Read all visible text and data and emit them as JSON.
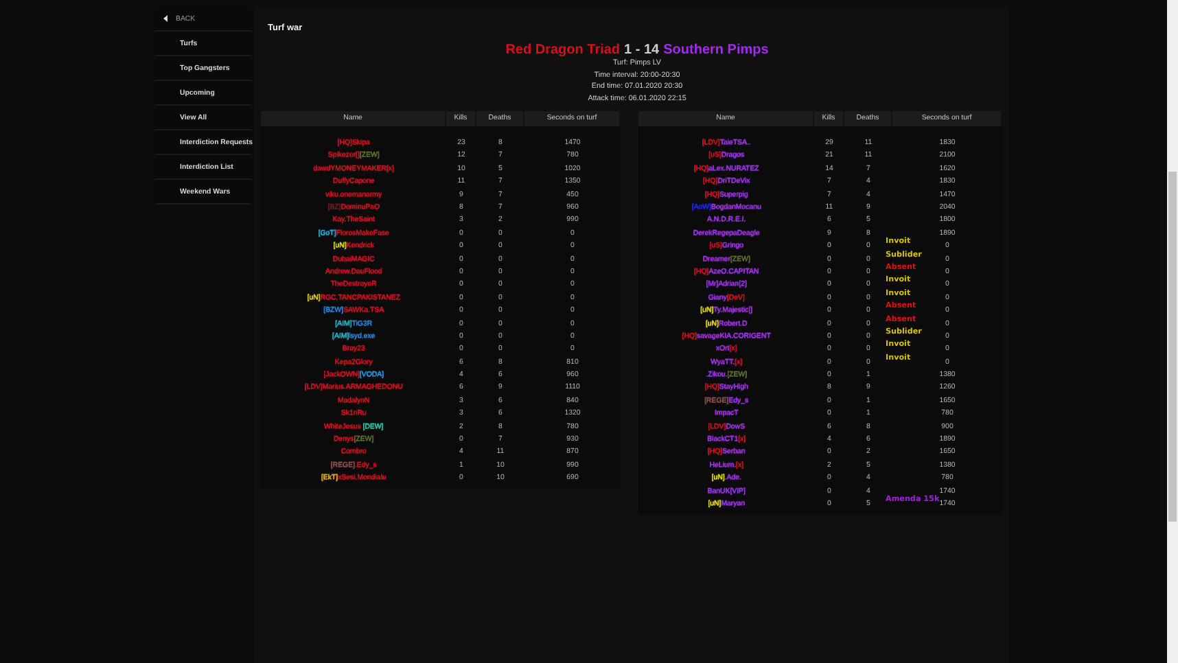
{
  "sidebar": {
    "items": [
      {
        "label": "BACK",
        "kind": "back"
      },
      {
        "label": "Turfs",
        "kind": "link"
      },
      {
        "label": "Top Gangsters",
        "kind": "link"
      },
      {
        "label": "Upcoming",
        "kind": "link"
      },
      {
        "label": "View All",
        "kind": "link"
      },
      {
        "label": "Interdiction Requests",
        "kind": "link"
      },
      {
        "label": "Interdiction List",
        "kind": "link"
      },
      {
        "label": "Weekend Wars",
        "kind": "link"
      }
    ]
  },
  "page_title": "Turf war",
  "matchup": [
    {
      "text": "Red Dragon Triad",
      "color": "#d8101c"
    },
    {
      "text": "1 - 14",
      "color": "#cfcfcf"
    },
    {
      "text": "Southern Pimps",
      "color": "#a12bf0"
    }
  ],
  "info": [
    "Turf: Pimps LV",
    "Time interval: 20:00-20:30",
    "End time: 07.01.2020 20:30",
    "Attack time: 06.01.2020 22:15"
  ],
  "tables": [
    {
      "columns": [
        "Name",
        "Kills",
        "Deaths",
        "Seconds on turf"
      ],
      "rows": [
        {
          "name": [
            {
              "text": "[HQ]Skipa",
              "color": "#c8101e"
            }
          ],
          "kills": "23",
          "deaths": "8",
          "seconds": "1470"
        },
        {
          "name": [
            {
              "text": "Spikezor[]",
              "color": "#c8101e"
            },
            {
              "text": "[ZEW]",
              "color": "#5a6b2a"
            }
          ],
          "kills": "12",
          "deaths": "7",
          "seconds": "780"
        },
        {
          "name": [
            {
              "text": "dawdYMONEYMAKER[x]",
              "color": "#c8101e"
            }
          ],
          "kills": "10",
          "deaths": "5",
          "seconds": "1020"
        },
        {
          "name": [
            {
              "text": "DuffyCapone",
              "color": "#c8101e"
            }
          ],
          "kills": "11",
          "deaths": "7",
          "seconds": "1350"
        },
        {
          "name": [
            {
              "text": "viku.onemanarmy",
              "color": "#c8101e"
            }
          ],
          "kills": "9",
          "deaths": "7",
          "seconds": "450"
        },
        {
          "name": [
            {
              "text": "[BZ]",
              "color": "#6a1a22"
            },
            {
              "text": "DominuPaO",
              "color": "#c8101e"
            }
          ],
          "kills": "8",
          "deaths": "7",
          "seconds": "960"
        },
        {
          "name": [
            {
              "text": "Kay.TheSaint",
              "color": "#c8101e"
            }
          ],
          "kills": "3",
          "deaths": "2",
          "seconds": "990"
        },
        {
          "name": [
            {
              "text": "[GoT]",
              "color": "#1fa8d0"
            },
            {
              "text": "FlorosMakeFase",
              "color": "#c8101e"
            }
          ],
          "kills": "0",
          "deaths": "0",
          "seconds": "0"
        },
        {
          "name": [
            {
              "text": "[uN]",
              "color": "#d8d000"
            },
            {
              "text": "Kendrick",
              "color": "#c8101e"
            }
          ],
          "kills": "0",
          "deaths": "0",
          "seconds": "0"
        },
        {
          "name": [
            {
              "text": "DubaiMAGIC",
              "color": "#c8101e"
            }
          ],
          "kills": "0",
          "deaths": "0",
          "seconds": "0"
        },
        {
          "name": [
            {
              "text": "Andrew.DauFlood",
              "color": "#c8101e"
            }
          ],
          "kills": "0",
          "deaths": "0",
          "seconds": "0"
        },
        {
          "name": [
            {
              "text": "TheDestroyeR",
              "color": "#c8101e"
            }
          ],
          "kills": "0",
          "deaths": "0",
          "seconds": "0"
        },
        {
          "name": [
            {
              "text": "[uN]",
              "color": "#d8d000"
            },
            {
              "text": "RGC.TANCPAKISTANEZ",
              "color": "#c8101e"
            }
          ],
          "kills": "0",
          "deaths": "0",
          "seconds": "0"
        },
        {
          "name": [
            {
              "text": "[BZW]",
              "color": "#1f7fd0"
            },
            {
              "text": "SAWKa.TSA",
              "color": "#c8101e"
            }
          ],
          "kills": "0",
          "deaths": "0",
          "seconds": "0"
        },
        {
          "name": [
            {
              "text": "[AIM]",
              "color": "#19b0b8"
            },
            {
              "text": "TiG3R",
              "color": "#1f7fd0"
            }
          ],
          "kills": "0",
          "deaths": "0",
          "seconds": "0"
        },
        {
          "name": [
            {
              "text": "[AIM]",
              "color": "#19b0b8"
            },
            {
              "text": "lsyd.exe",
              "color": "#1f7fd0"
            }
          ],
          "kills": "0",
          "deaths": "0",
          "seconds": "0"
        },
        {
          "name": [
            {
              "text": "Bray23",
              "color": "#c8101e"
            }
          ],
          "kills": "0",
          "deaths": "0",
          "seconds": "0"
        },
        {
          "name": [
            {
              "text": "Kepa2Glory",
              "color": "#c8101e"
            }
          ],
          "kills": "6",
          "deaths": "8",
          "seconds": "810"
        },
        {
          "name": [
            {
              "text": "[JackOWN]",
              "color": "#c8101e"
            },
            {
              "text": "[VODA]",
              "color": "#1f8fd8"
            }
          ],
          "kills": "4",
          "deaths": "6",
          "seconds": "960"
        },
        {
          "name": [
            {
              "text": "[LDV]Marius.ARMAGHEDONU",
              "color": "#c8101e"
            }
          ],
          "kills": "6",
          "deaths": "9",
          "seconds": "1110"
        },
        {
          "name": [
            {
              "text": "MadalynN",
              "color": "#c8101e"
            }
          ],
          "kills": "3",
          "deaths": "6",
          "seconds": "840"
        },
        {
          "name": [
            {
              "text": "Sk1nRu",
              "color": "#c8101e"
            }
          ],
          "kills": "3",
          "deaths": "6",
          "seconds": "1320"
        },
        {
          "name": [
            {
              "text": "WhiteJesus ",
              "color": "#c8101e"
            },
            {
              "text": "[DEW]",
              "color": "#20c0a0"
            }
          ],
          "kills": "2",
          "deaths": "8",
          "seconds": "780"
        },
        {
          "name": [
            {
              "text": "Denys",
              "color": "#c8101e"
            },
            {
              "text": "[ZEW]",
              "color": "#5a6b2a"
            }
          ],
          "kills": "0",
          "deaths": "7",
          "seconds": "930"
        },
        {
          "name": [
            {
              "text": "Combro",
              "color": "#c8101e"
            }
          ],
          "kills": "4",
          "deaths": "11",
          "seconds": "870"
        },
        {
          "name": [
            {
              "text": "[REGE]",
              "color": "#8a4a4a"
            },
            {
              "text": ".Edy_s",
              "color": "#c8101e"
            }
          ],
          "kills": "1",
          "deaths": "10",
          "seconds": "990"
        },
        {
          "name": [
            {
              "text": "[EkT]",
              "color": "#e0a000"
            },
            {
              "text": "xSesi.Mondialu",
              "color": "#c8101e"
            }
          ],
          "kills": "0",
          "deaths": "10",
          "seconds": "690"
        }
      ]
    },
    {
      "columns": [
        "Name",
        "Kills",
        "Deaths",
        "Seconds on turf"
      ],
      "rows": [
        {
          "name": [
            {
              "text": "[LDV]",
              "color": "#c8101e"
            },
            {
              "text": "TaieTSA..",
              "color": "#9a2ee0"
            }
          ],
          "kills": "29",
          "deaths": "11",
          "seconds": "1830"
        },
        {
          "name": [
            {
              "text": "[uS]",
              "color": "#c8101e"
            },
            {
              "text": "Dragos",
              "color": "#9a2ee0"
            }
          ],
          "kills": "21",
          "deaths": "11",
          "seconds": "2100"
        },
        {
          "name": [
            {
              "text": "[HQ]",
              "color": "#c8101e"
            },
            {
              "text": "aLex.NURATEZ",
              "color": "#9a2ee0"
            }
          ],
          "kills": "14",
          "deaths": "7",
          "seconds": "1620"
        },
        {
          "name": [
            {
              "text": "[HQ]",
              "color": "#c8101e"
            },
            {
              "text": "DriTDeVix",
              "color": "#9a2ee0"
            }
          ],
          "kills": "7",
          "deaths": "4",
          "seconds": "1830"
        },
        {
          "name": [
            {
              "text": "[HQ]",
              "color": "#c8101e"
            },
            {
              "text": "Superpig",
              "color": "#9a2ee0"
            }
          ],
          "kills": "7",
          "deaths": "4",
          "seconds": "1470"
        },
        {
          "name": [
            {
              "text": "[AoW]",
              "color": "#2020f0"
            },
            {
              "text": "BogdanMocanu",
              "color": "#9a2ee0"
            }
          ],
          "kills": "11",
          "deaths": "9",
          "seconds": "2040"
        },
        {
          "name": [
            {
              "text": "A.N.D.R.E.I.",
              "color": "#9a2ee0"
            }
          ],
          "kills": "6",
          "deaths": "5",
          "seconds": "1800"
        },
        {
          "name": [
            {
              "text": "DerekRegepaDeagle",
              "color": "#9a2ee0"
            }
          ],
          "kills": "9",
          "deaths": "8",
          "seconds": "1890"
        },
        {
          "name": [
            {
              "text": "[uS]",
              "color": "#c8101e"
            },
            {
              "text": "Gringo",
              "color": "#9a2ee0"
            }
          ],
          "kills": "0",
          "deaths": "0",
          "seconds": "0",
          "note": {
            "text": "Invoit",
            "color": "#d8c000"
          }
        },
        {
          "name": [
            {
              "text": "Dreamer",
              "color": "#9a2ee0"
            },
            {
              "text": "[ZEW]",
              "color": "#5a6b2a"
            }
          ],
          "kills": "0",
          "deaths": "0",
          "seconds": "0",
          "note": {
            "text": "Sublider",
            "color": "#d8c000"
          }
        },
        {
          "name": [
            {
              "text": "[HQ]",
              "color": "#c8101e"
            },
            {
              "text": "AzeO.CAPITAN",
              "color": "#9a2ee0"
            }
          ],
          "kills": "0",
          "deaths": "0",
          "seconds": "0",
          "note": {
            "text": "Absent",
            "color": "#e01010"
          }
        },
        {
          "name": [
            {
              "text": "[Mr]Adrian[2]",
              "color": "#9a2ee0"
            }
          ],
          "kills": "0",
          "deaths": "0",
          "seconds": "0",
          "note": {
            "text": "Invoit",
            "color": "#d8c000"
          }
        },
        {
          "name": [
            {
              "text": "Giany",
              "color": "#9a2ee0"
            },
            {
              "text": "[DeV]",
              "color": "#c8101e"
            }
          ],
          "kills": "0",
          "deaths": "0",
          "seconds": "0",
          "note": {
            "text": "Invoit",
            "color": "#d8c000"
          }
        },
        {
          "name": [
            {
              "text": "[uN]",
              "color": "#d8d000"
            },
            {
              "text": "Ty.Majestic[]",
              "color": "#9a2ee0"
            }
          ],
          "kills": "0",
          "deaths": "0",
          "seconds": "0",
          "note": {
            "text": "Absent",
            "color": "#e01010"
          }
        },
        {
          "name": [
            {
              "text": "[uN]",
              "color": "#d8d000"
            },
            {
              "text": "Robert.D",
              "color": "#9a2ee0"
            }
          ],
          "kills": "0",
          "deaths": "0",
          "seconds": "0",
          "note": {
            "text": "Absent",
            "color": "#e01010"
          }
        },
        {
          "name": [
            {
              "text": "[HQ]",
              "color": "#c8101e"
            },
            {
              "text": "savageKIA.CORIGENT",
              "color": "#9a2ee0"
            }
          ],
          "kills": "0",
          "deaths": "0",
          "seconds": "0",
          "note": {
            "text": "Sublider",
            "color": "#d8c000"
          }
        },
        {
          "name": [
            {
              "text": "xOrt",
              "color": "#9a2ee0"
            },
            {
              "text": "[x]",
              "color": "#c8101e"
            }
          ],
          "kills": "0",
          "deaths": "0",
          "seconds": "0",
          "note": {
            "text": "Invoit",
            "color": "#d8c000"
          }
        },
        {
          "name": [
            {
              "text": "WyaTT.",
              "color": "#9a2ee0"
            },
            {
              "text": "[x]",
              "color": "#c8101e"
            }
          ],
          "kills": "0",
          "deaths": "0",
          "seconds": "0",
          "note": {
            "text": "Invoit",
            "color": "#d8c000"
          }
        },
        {
          "name": [
            {
              "text": ".Zikou.",
              "color": "#9a2ee0"
            },
            {
              "text": "[ZEW]",
              "color": "#5a6b2a"
            }
          ],
          "kills": "0",
          "deaths": "1",
          "seconds": "1380"
        },
        {
          "name": [
            {
              "text": "[HQ]",
              "color": "#c8101e"
            },
            {
              "text": "StayHigh",
              "color": "#9a2ee0"
            }
          ],
          "kills": "8",
          "deaths": "9",
          "seconds": "1260"
        },
        {
          "name": [
            {
              "text": "[REGE]",
              "color": "#8a4a4a"
            },
            {
              "text": "Edy_s",
              "color": "#9a2ee0"
            }
          ],
          "kills": "0",
          "deaths": "1",
          "seconds": "1650"
        },
        {
          "name": [
            {
              "text": "ImpacT",
              "color": "#9a2ee0"
            }
          ],
          "kills": "0",
          "deaths": "1",
          "seconds": "780"
        },
        {
          "name": [
            {
              "text": "[LDV]",
              "color": "#c8101e"
            },
            {
              "text": "DowS",
              "color": "#9a2ee0"
            }
          ],
          "kills": "6",
          "deaths": "8",
          "seconds": "900"
        },
        {
          "name": [
            {
              "text": "BlackCT1",
              "color": "#9a2ee0"
            },
            {
              "text": "[x]",
              "color": "#c8101e"
            }
          ],
          "kills": "4",
          "deaths": "6",
          "seconds": "1890"
        },
        {
          "name": [
            {
              "text": "[HQ]",
              "color": "#c8101e"
            },
            {
              "text": "Serban",
              "color": "#9a2ee0"
            }
          ],
          "kills": "0",
          "deaths": "2",
          "seconds": "1650"
        },
        {
          "name": [
            {
              "text": "HeLium.",
              "color": "#9a2ee0"
            },
            {
              "text": "[x]",
              "color": "#c8101e"
            }
          ],
          "kills": "2",
          "deaths": "5",
          "seconds": "1380"
        },
        {
          "name": [
            {
              "text": "[uN]",
              "color": "#d8d000"
            },
            {
              "text": ".Ade.",
              "color": "#9a2ee0"
            }
          ],
          "kills": "0",
          "deaths": "4",
          "seconds": "780"
        },
        {
          "name": [
            {
              "text": "BanUK[VIP]",
              "color": "#9a2ee0"
            }
          ],
          "kills": "0",
          "deaths": "4",
          "seconds": "1740"
        },
        {
          "name": [
            {
              "text": "[uN]",
              "color": "#d8d000"
            },
            {
              "text": "Maryan",
              "color": "#9a2ee0"
            }
          ],
          "kills": "0",
          "deaths": "5",
          "seconds": "1740",
          "note": {
            "text": "Amenda 15k",
            "color": "#a020e0"
          }
        }
      ]
    }
  ]
}
